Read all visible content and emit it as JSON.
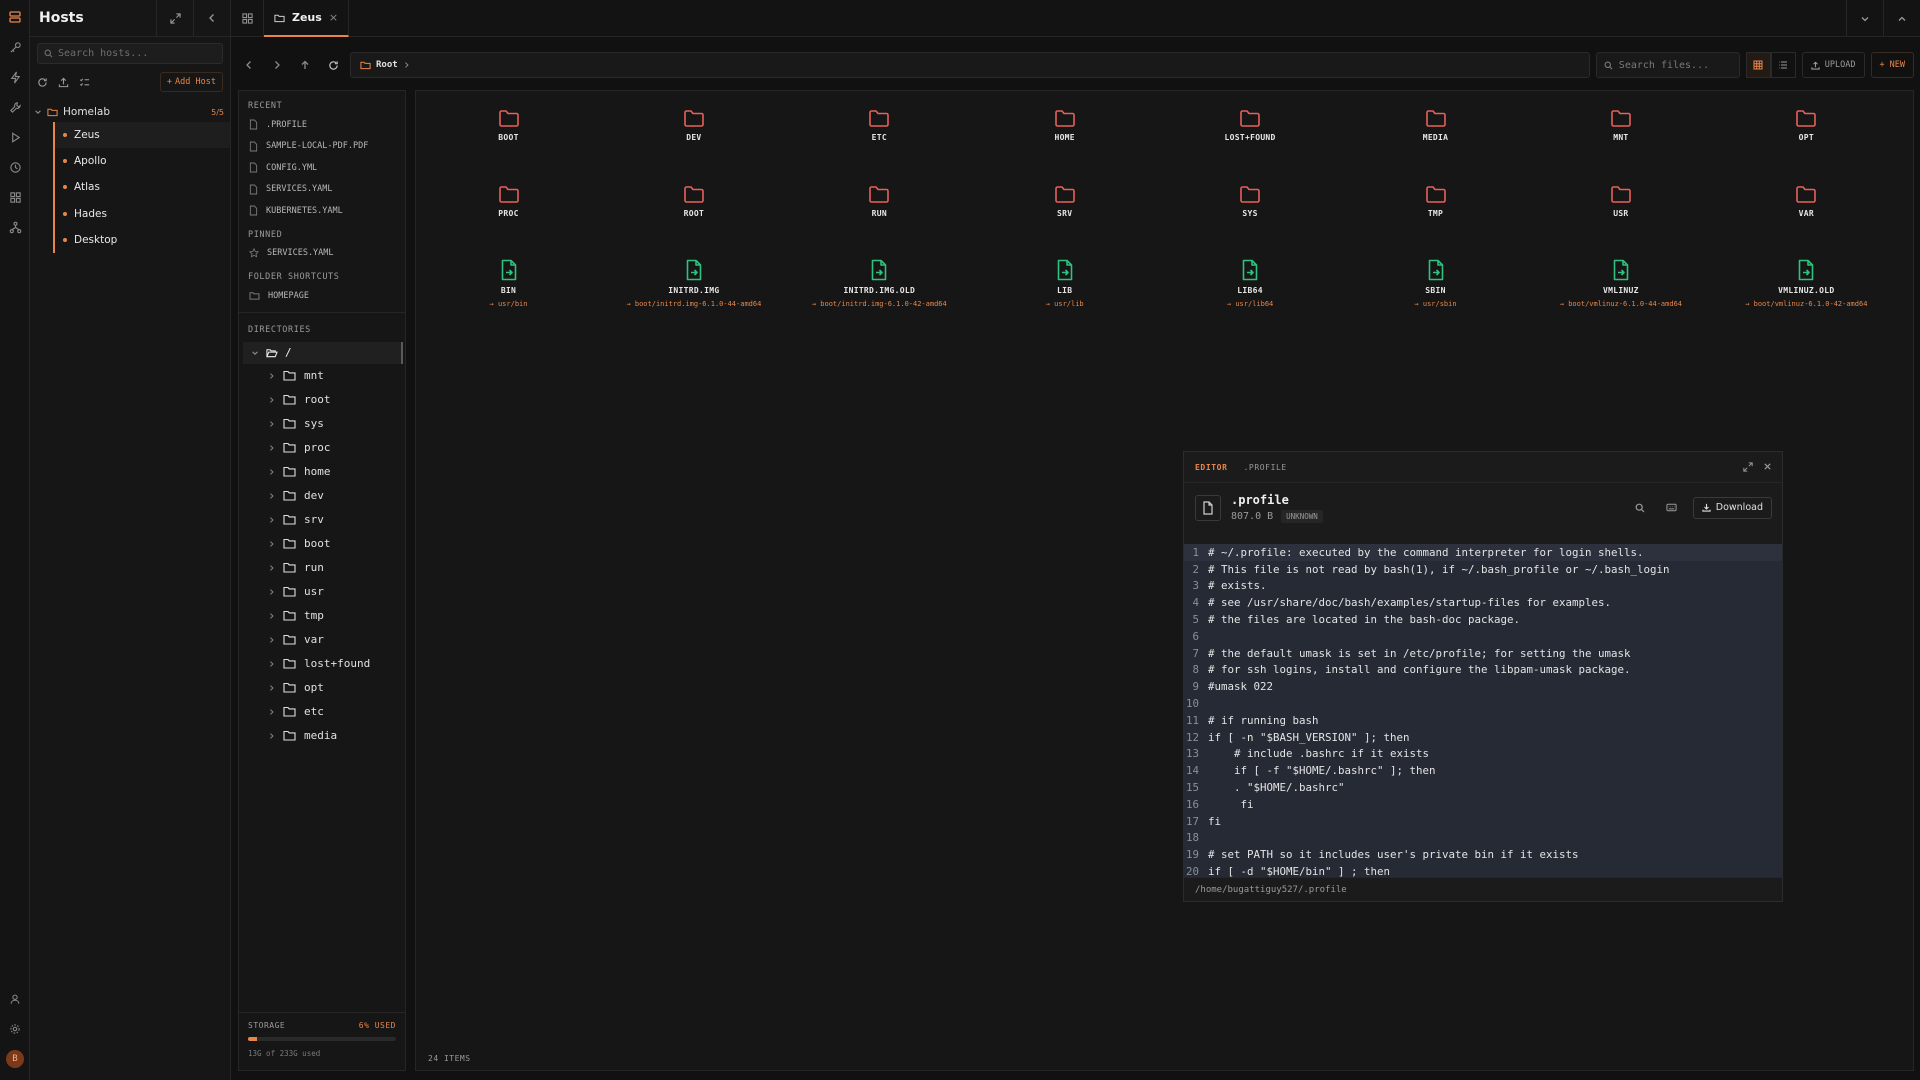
{
  "hosts_panel": {
    "title": "Hosts",
    "search_placeholder": "Search hosts...",
    "add_host_label": "Add Host",
    "group": {
      "name": "Homelab",
      "count": "5/5"
    },
    "hosts": [
      "Zeus",
      "Apollo",
      "Atlas",
      "Hades",
      "Desktop"
    ]
  },
  "user": {
    "avatar_initial": "B"
  },
  "tabs": [
    {
      "label": "Zeus",
      "close": "×"
    }
  ],
  "file_toolbar": {
    "path": "Root",
    "search_placeholder": "Search files...",
    "upload_label": "UPLOAD",
    "new_label": "NEW"
  },
  "sidebar": {
    "recent_title": "RECENT",
    "recent": [
      ".PROFILE",
      "SAMPLE-LOCAL-PDF.PDF",
      "CONFIG.YML",
      "SERVICES.YAML",
      "KUBERNETES.YAML"
    ],
    "pinned_title": "PINNED",
    "pinned": [
      "SERVICES.YAML"
    ],
    "shortcuts_title": "FOLDER SHORTCUTS",
    "shortcuts": [
      "HOMEPAGE"
    ],
    "directories_title": "DIRECTORIES",
    "root_dir": "/",
    "directories": [
      "mnt",
      "root",
      "sys",
      "proc",
      "home",
      "dev",
      "srv",
      "boot",
      "run",
      "usr",
      "tmp",
      "var",
      "lost+found",
      "opt",
      "etc",
      "media"
    ],
    "storage": {
      "title": "STORAGE",
      "used_label": "6% USED",
      "used_fraction": 0.06,
      "detail": "13G of 233G used"
    }
  },
  "files": {
    "folders": [
      "BOOT",
      "DEV",
      "ETC",
      "HOME",
      "LOST+FOUND",
      "MEDIA",
      "MNT",
      "OPT",
      "PROC",
      "ROOT",
      "RUN",
      "SRV",
      "SYS",
      "TMP",
      "USR",
      "VAR"
    ],
    "links": [
      {
        "name": "BIN",
        "target": "→ usr/bin"
      },
      {
        "name": "INITRD.IMG",
        "target": "→ boot/initrd.img-6.1.0-44-amd64"
      },
      {
        "name": "INITRD.IMG.OLD",
        "target": "→ boot/initrd.img-6.1.0-42-amd64"
      },
      {
        "name": "LIB",
        "target": "→ usr/lib"
      },
      {
        "name": "LIB64",
        "target": "→ usr/lib64"
      },
      {
        "name": "SBIN",
        "target": "→ usr/sbin"
      },
      {
        "name": "VMLINUZ",
        "target": "→ boot/vmlinuz-6.1.0-44-amd64"
      },
      {
        "name": "VMLINUZ.OLD",
        "target": "→ boot/vmlinuz-6.1.0-42-amd64"
      }
    ],
    "item_count": "24 ITEMS"
  },
  "editor": {
    "tag": "EDITOR",
    "tab_file": ".PROFILE",
    "file_name": ".profile",
    "file_size": "807.0 B",
    "language_badge": "UNKNOWN",
    "download_label": "Download",
    "path": "/home/bugattiguy527/.profile",
    "lines": [
      "# ~/.profile: executed by the command interpreter for login shells.",
      "# This file is not read by bash(1), if ~/.bash_profile or ~/.bash_login",
      "# exists.",
      "# see /usr/share/doc/bash/examples/startup-files for examples.",
      "# the files are located in the bash-doc package.",
      "",
      "# the default umask is set in /etc/profile; for setting the umask",
      "# for ssh logins, install and configure the libpam-umask package.",
      "#umask 022",
      "",
      "# if running bash",
      "if [ -n \"$BASH_VERSION\" ]; then",
      "    # include .bashrc if it exists",
      "    if [ -f \"$HOME/.bashrc\" ]; then",
      "    . \"$HOME/.bashrc\"",
      "     fi",
      "fi",
      "",
      "# set PATH so it includes user's private bin if it exists",
      "if [ -d \"$HOME/bin\" ] ; then"
    ]
  },
  "colors": {
    "accent": "#e8864a",
    "folder": "#e8605a",
    "link_file": "#2ec27e",
    "code_bg": "#252a35"
  }
}
